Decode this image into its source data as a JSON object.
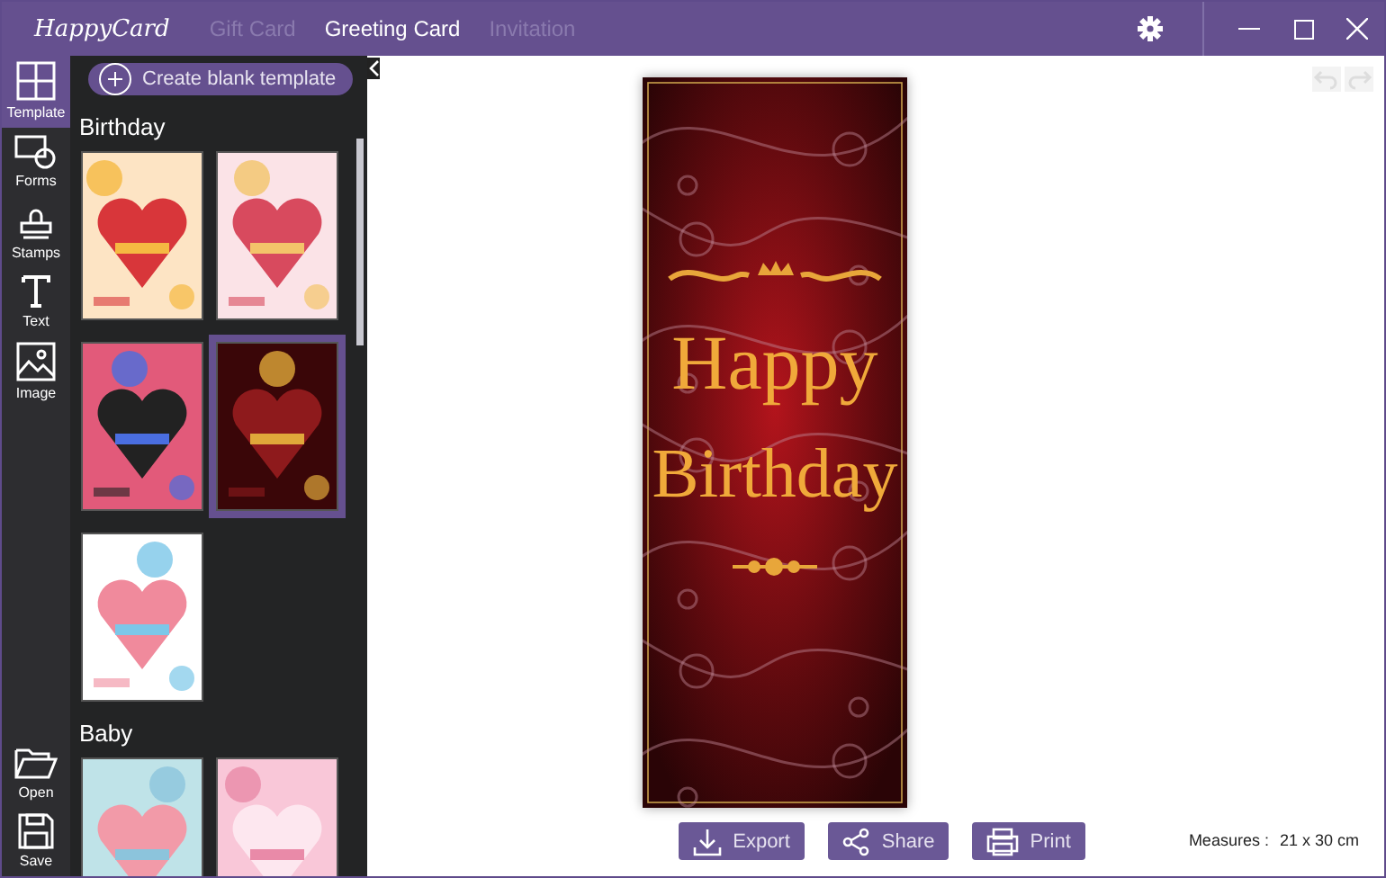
{
  "window": {
    "logo": "HappyCard",
    "tabs": [
      {
        "label": "Gift Card",
        "selected": false
      },
      {
        "label": "Greeting Card",
        "selected": true
      },
      {
        "label": "Invitation",
        "selected": false
      }
    ]
  },
  "rail": {
    "tools": [
      {
        "label": "Template",
        "selected": true
      },
      {
        "label": "Forms",
        "selected": false
      },
      {
        "label": "Stamps",
        "selected": false
      },
      {
        "label": "Text",
        "selected": false
      },
      {
        "label": "Image",
        "selected": false
      }
    ],
    "bottom": [
      {
        "label": "Open"
      },
      {
        "label": "Save"
      }
    ]
  },
  "panel": {
    "create_button": "Create blank template",
    "sections": [
      {
        "title": "Birthday",
        "items": [
          {
            "selected": false
          },
          {
            "selected": false
          },
          {
            "selected": false
          },
          {
            "selected": true
          },
          {
            "selected": false
          }
        ]
      },
      {
        "title": "Baby",
        "items": [
          {
            "selected": false
          },
          {
            "selected": false
          }
        ]
      }
    ]
  },
  "card": {
    "lines": [
      "Happy",
      "Birthday"
    ]
  },
  "actions": [
    {
      "label": "Export"
    },
    {
      "label": "Share"
    },
    {
      "label": "Print"
    }
  ],
  "measures": {
    "label": "Measures :",
    "value": "21 x 30 cm"
  }
}
